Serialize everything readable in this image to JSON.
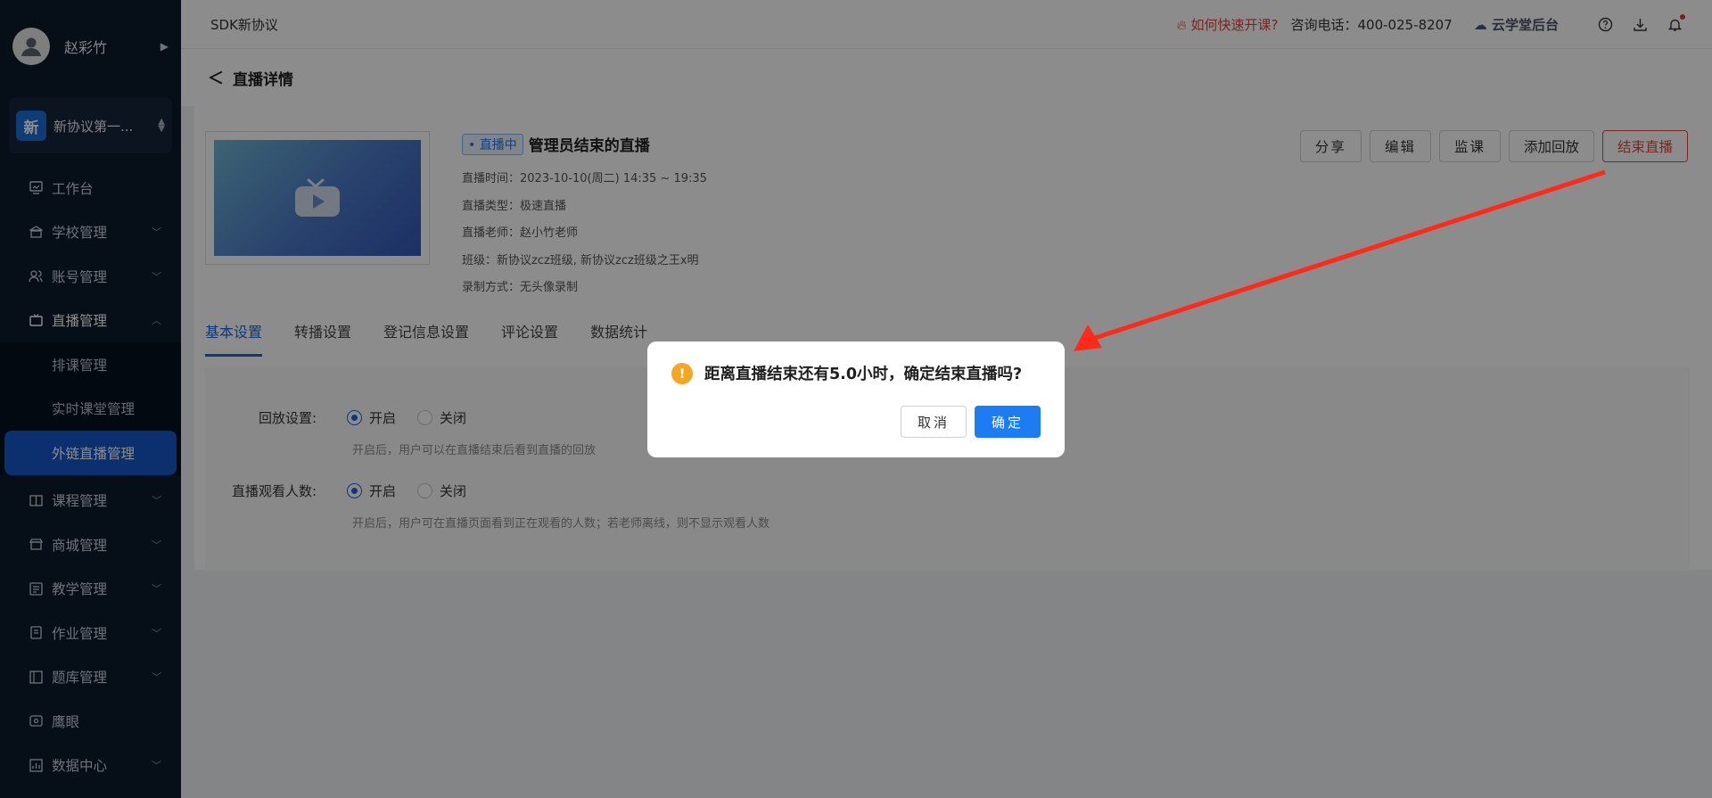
{
  "sidebar": {
    "user_name": "赵彩竹",
    "org_logo": "新",
    "org_name": "新协议第一...",
    "items": [
      {
        "label": "工作台"
      },
      {
        "label": "学校管理"
      },
      {
        "label": "账号管理"
      },
      {
        "label": "直播管理"
      },
      {
        "label": "课程管理"
      },
      {
        "label": "商城管理"
      },
      {
        "label": "教学管理"
      },
      {
        "label": "作业管理"
      },
      {
        "label": "题库管理"
      },
      {
        "label": "鹰眼"
      },
      {
        "label": "数据中心"
      }
    ],
    "sub_items": [
      {
        "label": "排课管理"
      },
      {
        "label": "实时课堂管理"
      },
      {
        "label": "外链直播管理"
      }
    ]
  },
  "header": {
    "title": "SDK新协议",
    "quick_start": "如何快速开课?",
    "phone": "咨询电话：400-025-8207",
    "cloud": "云学堂后台"
  },
  "page": {
    "back_title": "直播详情",
    "live_tag": "• 直播中",
    "live_title": "管理员结束的直播",
    "meta": [
      "直播时间：2023-10-10(周二) 14:35 ~ 19:35",
      "直播类型：极速直播",
      "直播老师：赵小竹老师",
      "班级：新协议zcz班级, 新协议zcz班级之王x明",
      "录制方式：无头像录制"
    ],
    "actions": {
      "share": "分享",
      "edit": "编辑",
      "monitor": "监课",
      "add_replay": "添加回放",
      "end_live": "结束直播"
    },
    "tabs": [
      "基本设置",
      "转播设置",
      "登记信息设置",
      "评论设置",
      "数据统计"
    ],
    "settings": {
      "replay_label": "回放设置:",
      "replay_on": "开启",
      "replay_off": "关闭",
      "replay_hint": "开启后，用户可以在直播结束后看到直播的回放",
      "viewers_label": "直播观看人数:",
      "viewers_on": "开启",
      "viewers_off": "关闭",
      "viewers_hint": "开启后，用户可在直播页面看到正在观看的人数；若老师离线，则不显示观看人数"
    }
  },
  "dialog": {
    "icon": "!",
    "message": "距离直播结束还有5.0小时，确定结束直播吗?",
    "cancel": "取消",
    "confirm": "确定"
  },
  "colors": {
    "sidebar_bg": "#0b1a2c",
    "primary": "#1d64e0",
    "danger": "#e04a3f",
    "warning": "#f5a623",
    "arrow": "#ff2a1a"
  }
}
